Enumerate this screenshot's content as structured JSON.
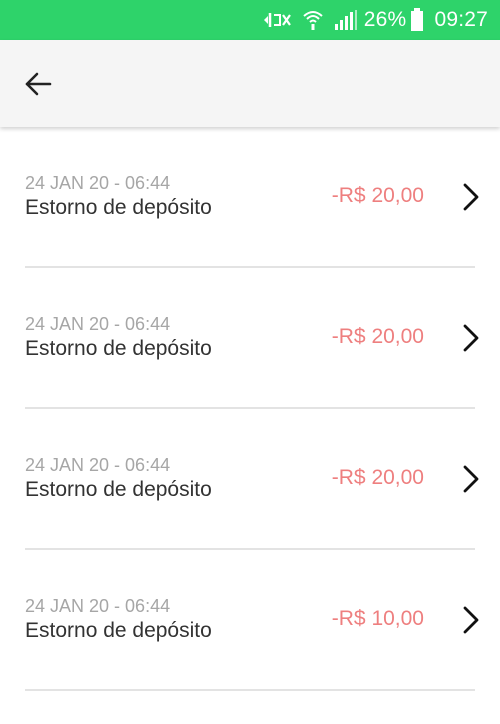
{
  "status_bar": {
    "battery_percent": "26%",
    "time": "09:27",
    "icons": [
      "mute-icon",
      "wifi-icon",
      "signal-icon",
      "battery-icon"
    ],
    "background_color": "#2ed36a"
  },
  "app_bar": {
    "back_icon": "arrow-left-icon"
  },
  "transactions": [
    {
      "date": "24 JAN 20 - 06:44",
      "description": "Estorno de depósito",
      "amount": "-R$ 20,00"
    },
    {
      "date": "24 JAN 20 - 06:44",
      "description": "Estorno de depósito",
      "amount": "-R$ 20,00"
    },
    {
      "date": "24 JAN 20 - 06:44",
      "description": "Estorno de depósito",
      "amount": "-R$ 20,00"
    },
    {
      "date": "24 JAN 20 - 06:44",
      "description": "Estorno de depósito",
      "amount": "-R$ 10,00"
    }
  ],
  "colors": {
    "amount_negative": "#ee7f7f",
    "date_text": "#a6a6a6",
    "divider": "#e3e3e3"
  }
}
